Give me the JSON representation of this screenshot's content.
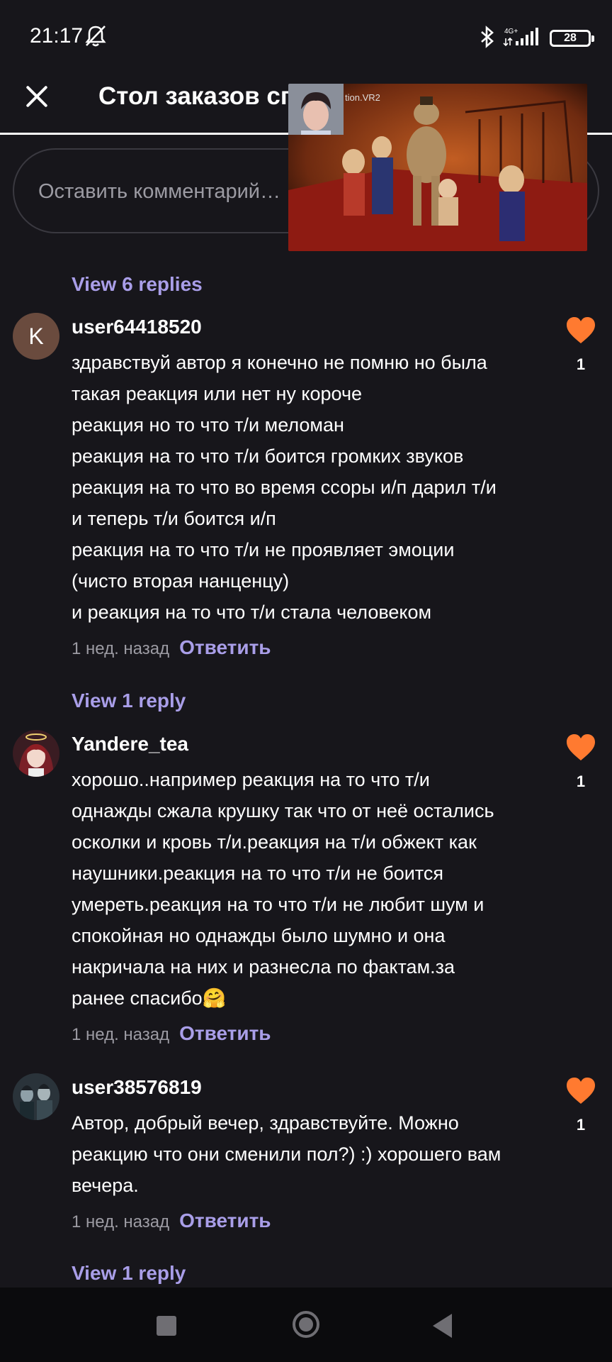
{
  "status_bar": {
    "time": "21:17",
    "network": "4G+",
    "battery": "28",
    "icons": [
      "bell-off-icon",
      "bluetooth-icon",
      "signal-icon",
      "battery-icon"
    ]
  },
  "header": {
    "title": "Стол заказов сп",
    "close_icon": "close-icon"
  },
  "comment_input": {
    "placeholder": "Оставить комментарий…"
  },
  "video_overlay": {
    "channel_label": "tion.VR2"
  },
  "threads": [
    {
      "view_replies": "View 6 replies"
    },
    {
      "avatar_letter": "K",
      "username": "user64418520",
      "lines": [
        "здравствуй автор я конечно не помню но была",
        "такая реакция или нет ну короче",
        "реакция но то что т/и меломан",
        "реакция на то что т/и боится громких звуков",
        "реакция на то что во время ссоры и/п дарил т/и",
        "и теперь т/и боится и/п",
        "реакция на то что т/и не проявляет эмоции",
        "(чисто вторая нанценцу)",
        "и реакция на то что т/и стала человеком"
      ],
      "time": "1 нед. назад",
      "reply_label": "Ответить",
      "likes": "1",
      "view_replies": "View 1 reply"
    },
    {
      "username": "Yandere_tea",
      "lines": [
        "хорошо..например реакция на то что т/и",
        "однажды сжала крушку так что от неё остались",
        "осколки и кровь т/и.реакция на т/и обжект как",
        "наушники.реакция на то что т/и не боится",
        "умереть.реакция на то что т/и не любит шум и",
        "спокойная но однажды было шумно и она",
        "накричала на них и разнесла по фактам.за",
        "ранее спасибо🤗"
      ],
      "time": "1 нед. назад",
      "reply_label": "Ответить",
      "likes": "1"
    },
    {
      "username": "user38576819",
      "lines": [
        "Автор, добрый вечер, здравствуйте. Можно",
        "реакцию что они сменили пол?) :) хорошего вам",
        "вечера."
      ],
      "time": "1 нед. назад",
      "reply_label": "Ответить",
      "likes": "1",
      "view_replies": "View 1 reply"
    }
  ],
  "colors": {
    "background": "#17161b",
    "accent": "#a99ee8",
    "heart": "#ff7a30",
    "muted": "#9c9ba3"
  }
}
